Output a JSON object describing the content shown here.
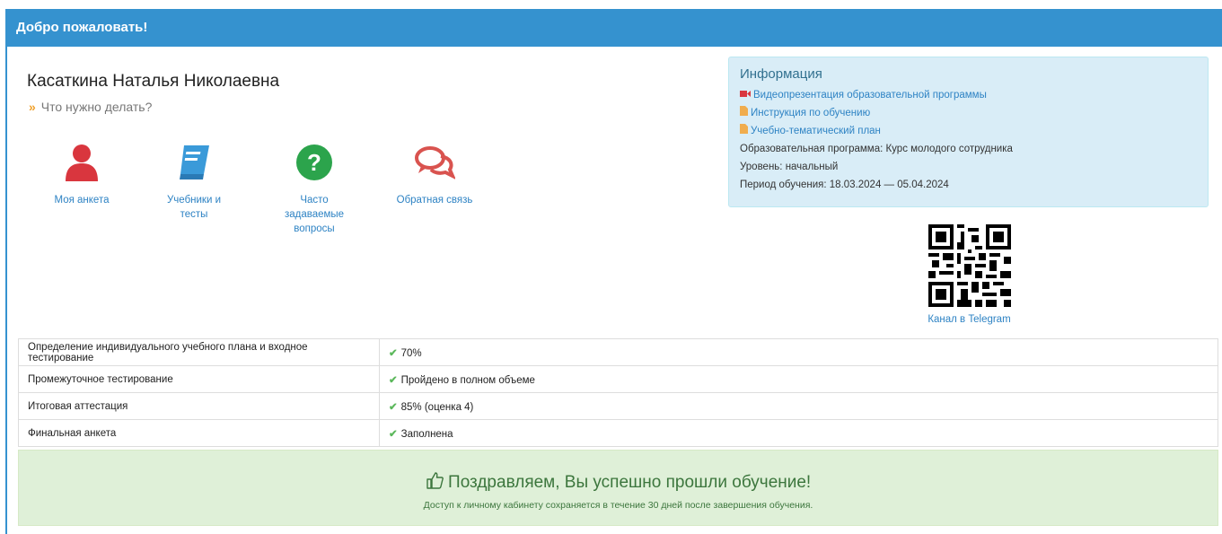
{
  "header": {
    "title": "Добро пожаловать!"
  },
  "user": {
    "name": "Касаткина Наталья Николаевна",
    "todo": "Что нужно делать?"
  },
  "actions": [
    {
      "label": "Моя анкета",
      "icon": "user-icon",
      "color": "#d9363e"
    },
    {
      "label": "Учебники и тесты",
      "icon": "book-icon",
      "color": "#3a9ad9"
    },
    {
      "label": "Часто задаваемые вопросы",
      "icon": "question-icon",
      "color": "#2ca44c"
    },
    {
      "label": "Обратная связь",
      "icon": "comments-icon",
      "color": "#d9534f"
    }
  ],
  "info": {
    "title": "Информация",
    "links": [
      {
        "label": "Видеопрезентация образовательной программы",
        "icon": "video-icon",
        "color": "#d9363e"
      },
      {
        "label": "Инструкция по обучению",
        "icon": "file-icon",
        "color": "#f0ad4e"
      },
      {
        "label": "Учебно-тематический план",
        "icon": "file-icon",
        "color": "#f0ad4e"
      }
    ],
    "program": "Образовательная программа: Курс молодого сотрудника",
    "level": "Уровень: начальный",
    "period": "Период обучения: 18.03.2024 — 05.04.2024"
  },
  "qr": {
    "link": "Канал в Telegram"
  },
  "progress": [
    {
      "label": "Определение индивидуального учебного плана и входное тестирование",
      "value": "70%"
    },
    {
      "label": "Промежуточное тестирование",
      "value": "Пройдено в полном объеме"
    },
    {
      "label": "Итоговая аттестация",
      "value": "85% (оценка 4)"
    },
    {
      "label": "Финальная анкета",
      "value": "Заполнена"
    }
  ],
  "success": {
    "title": "Поздравляем, Вы успешно прошли обучение!",
    "note": "Доступ к личному кабинету сохраняется в течение 30 дней после завершения обучения."
  }
}
